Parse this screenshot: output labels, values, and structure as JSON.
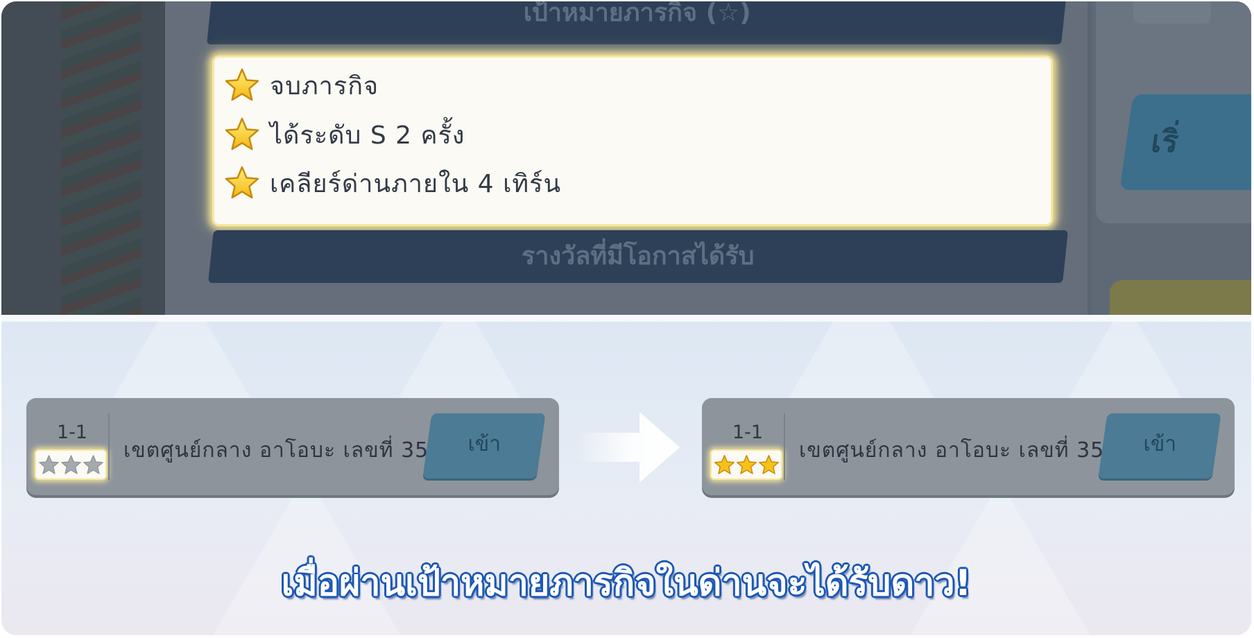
{
  "top_panel": {
    "mission_goal_header": "เป้าหมายภารกิจ (☆)",
    "goals": [
      {
        "label": "จบภารกิจ"
      },
      {
        "label": "ได้ระดับ S 2 ครั้ง"
      },
      {
        "label": "เคลียร์ด่านภายใน 4 เทิร์น"
      }
    ],
    "possible_rewards_header": "รางวัลที่มีโอกาสได้รับ",
    "start_button_partial": "เริ่"
  },
  "before_card": {
    "stage_code": "1-1",
    "stage_name": "เขตศูนย์กลาง อาโอบะ เลขที่ 35",
    "enter_label": "เข้า",
    "stars_earned": 0,
    "stars_total": 3
  },
  "after_card": {
    "stage_code": "1-1",
    "stage_name": "เขตศูนย์กลาง อาโอบะ เลขที่ 35",
    "enter_label": "เข้า",
    "stars_earned": 3,
    "stars_total": 3
  },
  "caption": "เมื่อผ่านเป้าหมายภารกิจในด่านจะได้รับดาว!",
  "colors": {
    "star_gold": "#f6c21a",
    "star_gray": "#a5aaaf",
    "caption_outline": "#1d58b4",
    "enter_button": "#4c7b95"
  },
  "icons": {
    "goal_star": "star-icon",
    "transition": "arrow-right-icon"
  }
}
